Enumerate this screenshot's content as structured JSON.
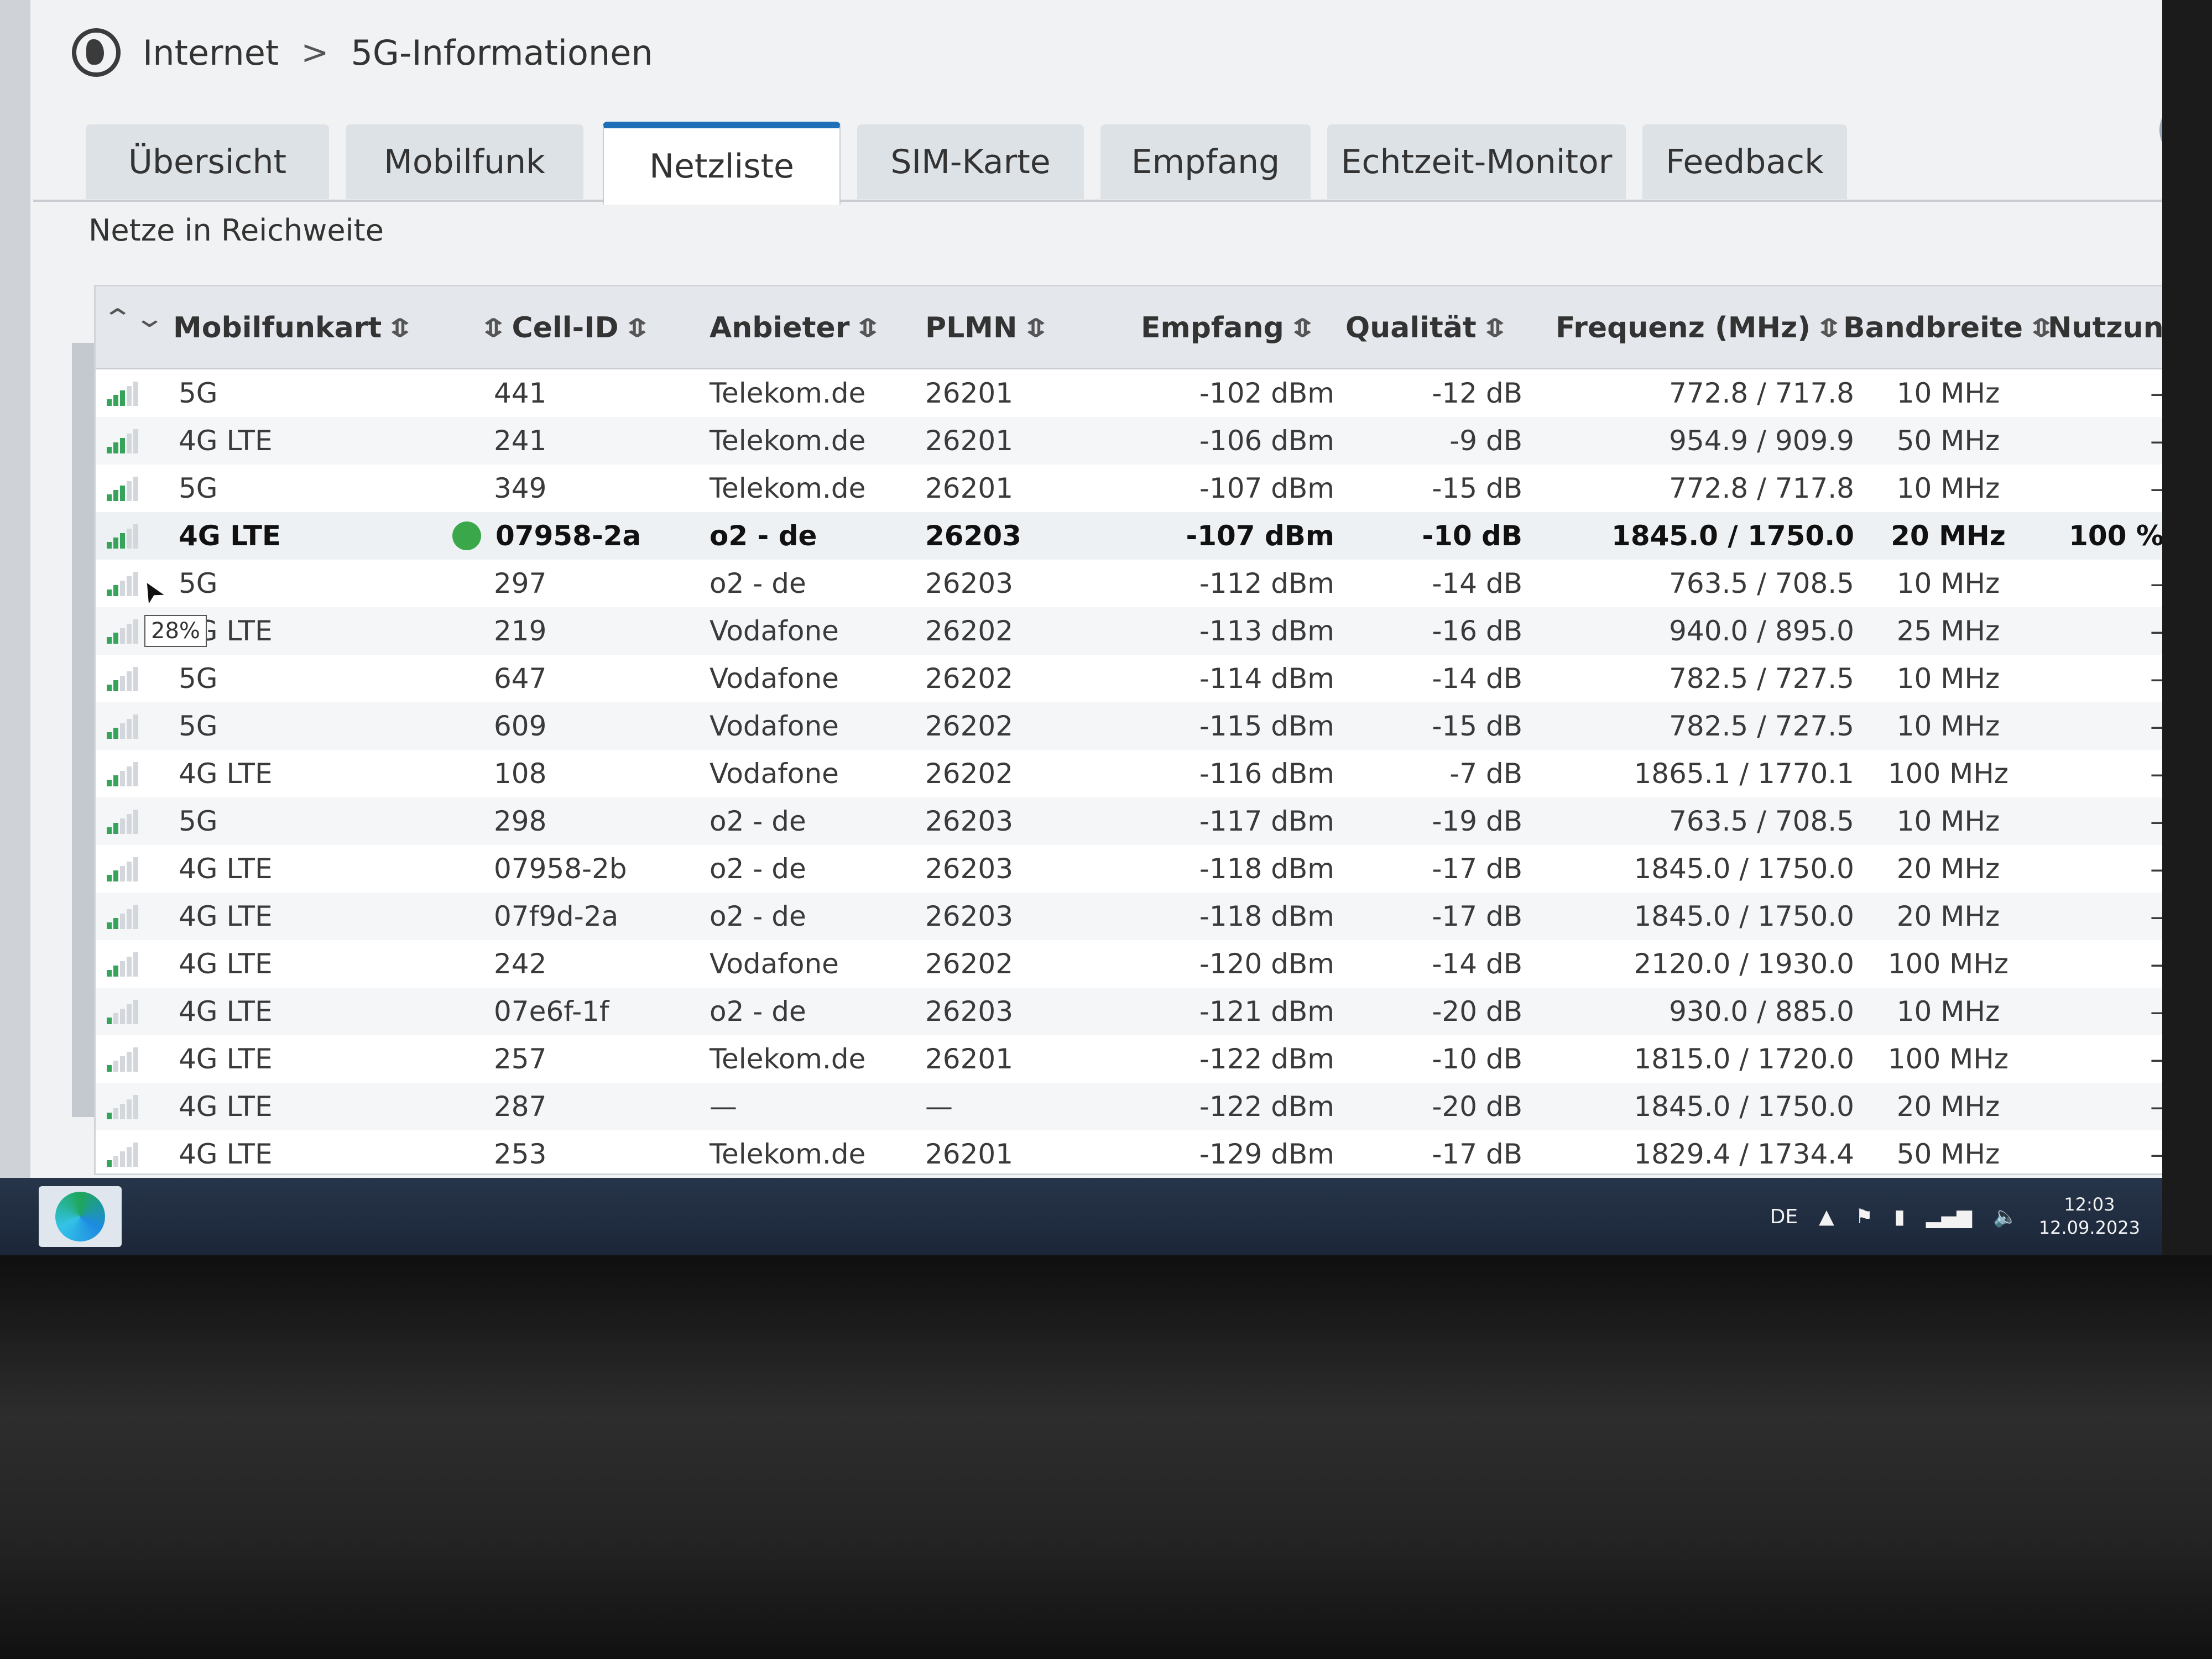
{
  "header": {
    "globe_icon": "globe-icon",
    "breadcrumb": [
      "Internet",
      "5G-Informationen"
    ],
    "separator": ">",
    "help_label": "?"
  },
  "tabs": [
    {
      "label": "Übersicht",
      "active": false
    },
    {
      "label": "Mobilfunk",
      "active": false
    },
    {
      "label": "Netzliste",
      "active": true
    },
    {
      "label": "SIM-Karte",
      "active": false
    },
    {
      "label": "Empfang",
      "active": false
    },
    {
      "label": "Echtzeit-Monitor",
      "active": false
    },
    {
      "label": "Feedback",
      "active": false
    }
  ],
  "section_title": "Netze in Reichweite",
  "table": {
    "columns": [
      "Mobilfunkart",
      "Cell-ID",
      "Anbieter",
      "PLMN",
      "Empfang",
      "Qualität",
      "Frequenz (MHz)",
      "Bandbreite",
      "Nutzung"
    ],
    "rows": [
      {
        "bars": 3,
        "type": "5G",
        "cell_id": "441",
        "provider": "Telekom.de",
        "plmn": "26201",
        "rx": "-102 dBm",
        "quality": "-12 dB",
        "freq": "772.8 / 717.8",
        "bw": "10 MHz",
        "usage": "–"
      },
      {
        "bars": 3,
        "type": "4G LTE",
        "cell_id": "241",
        "provider": "Telekom.de",
        "plmn": "26201",
        "rx": "-106 dBm",
        "quality": "-9 dB",
        "freq": "954.9 / 909.9",
        "bw": "50 MHz",
        "usage": "–"
      },
      {
        "bars": 3,
        "type": "5G",
        "cell_id": "349",
        "provider": "Telekom.de",
        "plmn": "26201",
        "rx": "-107 dBm",
        "quality": "-15 dB",
        "freq": "772.8 / 717.8",
        "bw": "10 MHz",
        "usage": "–"
      },
      {
        "bars": 3,
        "type": "4G LTE",
        "cell_id": "07958-2a",
        "provider": "o2 - de",
        "plmn": "26203",
        "rx": "-107 dBm",
        "quality": "-10 dB",
        "freq": "1845.0 / 1750.0",
        "bw": "20 MHz",
        "usage": "100 %",
        "active": true
      },
      {
        "bars": 2,
        "type": "5G",
        "cell_id": "297",
        "provider": "o2 - de",
        "plmn": "26203",
        "rx": "-112 dBm",
        "quality": "-14 dB",
        "freq": "763.5 / 708.5",
        "bw": "10 MHz",
        "usage": "–"
      },
      {
        "bars": 2,
        "type": "4G LTE",
        "cell_id": "219",
        "provider": "Vodafone",
        "plmn": "26202",
        "rx": "-113 dBm",
        "quality": "-16 dB",
        "freq": "940.0 / 895.0",
        "bw": "25 MHz",
        "usage": "–",
        "tooltip": "28%"
      },
      {
        "bars": 2,
        "type": "5G",
        "cell_id": "647",
        "provider": "Vodafone",
        "plmn": "26202",
        "rx": "-114 dBm",
        "quality": "-14 dB",
        "freq": "782.5 / 727.5",
        "bw": "10 MHz",
        "usage": "–"
      },
      {
        "bars": 2,
        "type": "5G",
        "cell_id": "609",
        "provider": "Vodafone",
        "plmn": "26202",
        "rx": "-115 dBm",
        "quality": "-15 dB",
        "freq": "782.5 / 727.5",
        "bw": "10 MHz",
        "usage": "–"
      },
      {
        "bars": 2,
        "type": "4G LTE",
        "cell_id": "108",
        "provider": "Vodafone",
        "plmn": "26202",
        "rx": "-116 dBm",
        "quality": "-7 dB",
        "freq": "1865.1 / 1770.1",
        "bw": "100 MHz",
        "usage": "–"
      },
      {
        "bars": 2,
        "type": "5G",
        "cell_id": "298",
        "provider": "o2 - de",
        "plmn": "26203",
        "rx": "-117 dBm",
        "quality": "-19 dB",
        "freq": "763.5 / 708.5",
        "bw": "10 MHz",
        "usage": "–"
      },
      {
        "bars": 2,
        "type": "4G LTE",
        "cell_id": "07958-2b",
        "provider": "o2 - de",
        "plmn": "26203",
        "rx": "-118 dBm",
        "quality": "-17 dB",
        "freq": "1845.0 / 1750.0",
        "bw": "20 MHz",
        "usage": "–"
      },
      {
        "bars": 2,
        "type": "4G LTE",
        "cell_id": "07f9d-2a",
        "provider": "o2 - de",
        "plmn": "26203",
        "rx": "-118 dBm",
        "quality": "-17 dB",
        "freq": "1845.0 / 1750.0",
        "bw": "20 MHz",
        "usage": "–"
      },
      {
        "bars": 2,
        "type": "4G LTE",
        "cell_id": "242",
        "provider": "Vodafone",
        "plmn": "26202",
        "rx": "-120 dBm",
        "quality": "-14 dB",
        "freq": "2120.0 / 1930.0",
        "bw": "100 MHz",
        "usage": "–"
      },
      {
        "bars": 1,
        "type": "4G LTE",
        "cell_id": "07e6f-1f",
        "provider": "o2 - de",
        "plmn": "26203",
        "rx": "-121 dBm",
        "quality": "-20 dB",
        "freq": "930.0 / 885.0",
        "bw": "10 MHz",
        "usage": "–"
      },
      {
        "bars": 1,
        "type": "4G LTE",
        "cell_id": "257",
        "provider": "Telekom.de",
        "plmn": "26201",
        "rx": "-122 dBm",
        "quality": "-10 dB",
        "freq": "1815.0 / 1720.0",
        "bw": "100 MHz",
        "usage": "–"
      },
      {
        "bars": 1,
        "type": "4G LTE",
        "cell_id": "287",
        "provider": "—",
        "plmn": "—",
        "rx": "-122 dBm",
        "quality": "-20 dB",
        "freq": "1845.0 / 1750.0",
        "bw": "20 MHz",
        "usage": "–"
      },
      {
        "bars": 1,
        "type": "4G LTE",
        "cell_id": "253",
        "provider": "Telekom.de",
        "plmn": "26201",
        "rx": "-129 dBm",
        "quality": "-17 dB",
        "freq": "1829.4 / 1734.4",
        "bw": "50 MHz",
        "usage": "–"
      }
    ]
  },
  "taskbar": {
    "language": "DE",
    "time": "12:03",
    "date": "12.09.2023"
  },
  "colors": {
    "accent": "#1e6fb8",
    "signal_on": "#35a35a",
    "signal_off": "#d3d7db",
    "active_dot": "#3aa84a"
  }
}
